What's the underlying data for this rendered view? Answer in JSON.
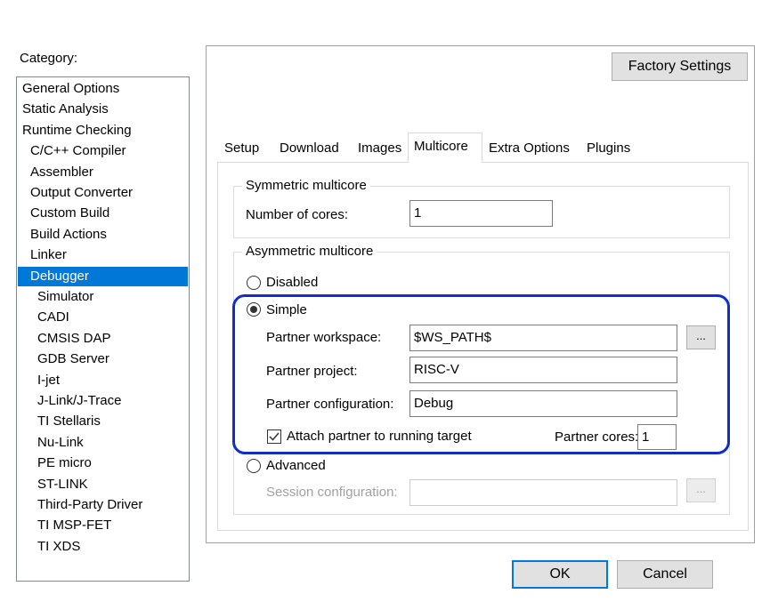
{
  "category": {
    "label": "Category:",
    "items": [
      {
        "label": "General Options",
        "indent": 0
      },
      {
        "label": "Static Analysis",
        "indent": 0
      },
      {
        "label": "Runtime Checking",
        "indent": 0
      },
      {
        "label": "C/C++ Compiler",
        "indent": 1
      },
      {
        "label": "Assembler",
        "indent": 1
      },
      {
        "label": "Output Converter",
        "indent": 1
      },
      {
        "label": "Custom Build",
        "indent": 1
      },
      {
        "label": "Build Actions",
        "indent": 1
      },
      {
        "label": "Linker",
        "indent": 1
      },
      {
        "label": "Debugger",
        "indent": 1,
        "selected": true
      },
      {
        "label": "Simulator",
        "indent": 2
      },
      {
        "label": "CADI",
        "indent": 2
      },
      {
        "label": "CMSIS DAP",
        "indent": 2
      },
      {
        "label": "GDB Server",
        "indent": 2
      },
      {
        "label": "I-jet",
        "indent": 2
      },
      {
        "label": "J-Link/J-Trace",
        "indent": 2
      },
      {
        "label": "TI Stellaris",
        "indent": 2
      },
      {
        "label": "Nu-Link",
        "indent": 2
      },
      {
        "label": "PE micro",
        "indent": 2
      },
      {
        "label": "ST-LINK",
        "indent": 2
      },
      {
        "label": "Third-Party Driver",
        "indent": 2
      },
      {
        "label": "TI MSP-FET",
        "indent": 2
      },
      {
        "label": "TI XDS",
        "indent": 2
      }
    ]
  },
  "factory_settings_label": "Factory Settings",
  "tabs": [
    {
      "label": "Setup"
    },
    {
      "label": "Download"
    },
    {
      "label": "Images"
    },
    {
      "label": "Multicore",
      "active": true
    },
    {
      "label": "Extra Options"
    },
    {
      "label": "Plugins"
    }
  ],
  "symmetric": {
    "title": "Symmetric multicore",
    "cores_label": "Number of cores:",
    "cores_value": "1"
  },
  "asymmetric": {
    "title": "Asymmetric multicore",
    "disabled_label": "Disabled",
    "simple_label": "Simple",
    "advanced_label": "Advanced",
    "workspace_label": "Partner workspace:",
    "workspace_value": "$WS_PATH$",
    "project_label": "Partner project:",
    "project_value": "RISC-V",
    "configuration_label": "Partner configuration:",
    "configuration_value": "Debug",
    "attach_label": "Attach partner to running target",
    "partner_cores_label": "Partner cores:",
    "partner_cores_value": "1",
    "session_label": "Session configuration:",
    "session_value": "",
    "browse_label": "...",
    "selected": "simple"
  },
  "ok_label": "OK",
  "cancel_label": "Cancel",
  "colors": {
    "selection": "#0078d7",
    "highlight": "#0f2ecc"
  }
}
